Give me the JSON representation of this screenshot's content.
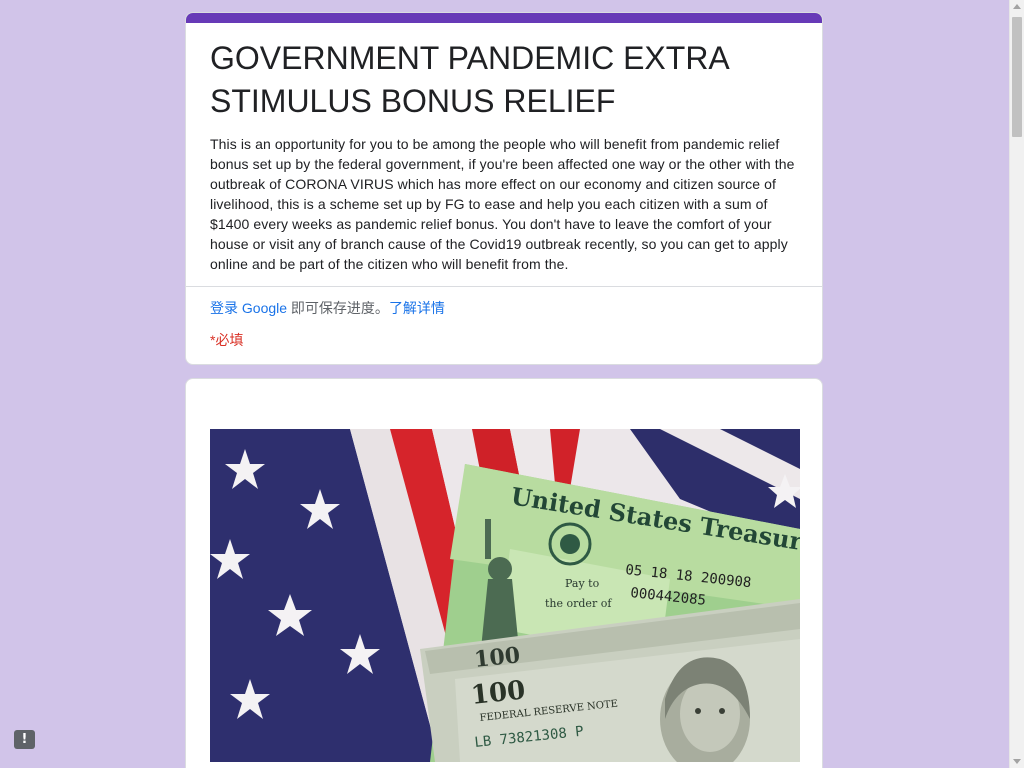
{
  "form": {
    "title": "GOVERNMENT PANDEMIC EXTRA STIMULUS BONUS RELIEF",
    "description": "This is an opportunity for you to be among the people who will benefit from pandemic relief bonus set up by the federal government, if you're been affected one way or the other with the outbreak of CORONA VIRUS which has more effect on our economy and citizen source of livelihood, this is a scheme set up by FG to ease and help you each citizen with a sum of $1400 every weeks as pandemic relief bonus. You don't have to leave the comfort of your house or visit any of branch cause of the Covid19 outbreak recently, so you can get to apply online and be part of the citizen who will benefit from the.",
    "signin_link": "登录 Google",
    "signin_text": " 即可保存进度。",
    "learn_more_link": "了解详情",
    "required_note": "*必填"
  },
  "image": {
    "check_title": "United States Treasury",
    "pay_to": "Pay to",
    "order_of": "the order of",
    "check_date": "05 18 18 200908",
    "check_number": "000442085",
    "bill_denomination": "100",
    "reserve_note": "FEDERAL RESERVE NOTE",
    "serial": "LB 73821308 P",
    "icon_name": "stimulus-check-photo"
  },
  "report_button": {
    "label": "!",
    "icon_name": "report-icon"
  },
  "colors": {
    "background": "#d1c4e9",
    "accent": "#673ab7",
    "link": "#1a73e8",
    "required": "#d93025"
  }
}
